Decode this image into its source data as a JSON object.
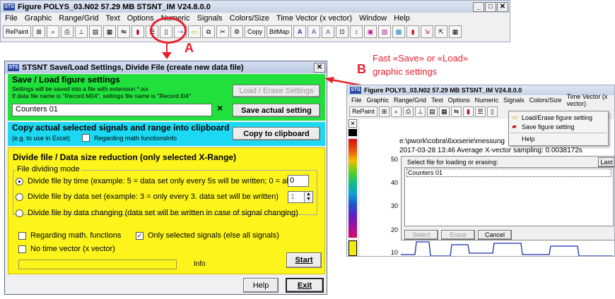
{
  "main_window": {
    "title": "Figure POLYS_03.N02  57.29 MB  STSNT_IM V24.8.0.0",
    "menu": [
      "File",
      "Graphic",
      "Range/Grid",
      "Text",
      "Options",
      "Numeric",
      "Signals",
      "Colors/Size",
      "Time Vector (x vector)",
      "Window",
      "Help"
    ],
    "toolbar": {
      "repaint": "RePaint",
      "copy": "Copy",
      "bitmap": "BitMap"
    }
  },
  "annotations": {
    "label_a": "A",
    "label_b": "B",
    "fast_text": "Fast «Save» or «Load»",
    "graphic_settings": "graphic settings",
    "arrow_color": "#e8202e"
  },
  "dialog": {
    "title": "STSNT Save/Load Settings, Divide File  (create new data file)",
    "save_load": {
      "heading": "Save / Load figure settings",
      "info1": "Settings will be saved into a file with extension *.ixx",
      "info2": "If data file name is \"Record.M04\", settings file name is \"Record.I04\"",
      "load_erase_btn": "Load / Erase Settings",
      "name_value": "Counters 01",
      "clear_x": "×",
      "save_btn": "Save actual setting"
    },
    "clipboard": {
      "heading": "Copy actual selected signals and range into clipboard",
      "sub": "(e.g. to use in Excel)",
      "math_label": "Regarding math functions",
      "info": "Info",
      "copy_btn": "Copy to clipboard"
    },
    "divide": {
      "heading": "Divide file / Data size reduction (only selected X-Range)",
      "group_label": "File dividing mode",
      "opt_time": "Divide file by time (example: 5 =  data set only every 5s will be written; 0 = all)",
      "opt_time_value": "0",
      "opt_set": "Divide file by data set (example: 3 = only every 3. data set will be written)",
      "opt_set_value": "1",
      "opt_change": "Divide file by data changing (data set will be written in case of signal changing)",
      "math_label": "Regarding math. functions",
      "only_selected_label": "Only selected signals (else all signals)",
      "no_time_label": "No time vector (x vector)",
      "info": "Info",
      "start_btn": "Start"
    },
    "help_btn": "Help",
    "exit_btn": "Exit"
  },
  "second_window": {
    "title": "Figure POLYS_03.N02  57.29 MB  STSNT_IM V24.8.0.0",
    "menu": [
      "File",
      "Graphic",
      "Range/Grid",
      "Text",
      "Options",
      "Numeric",
      "Signals",
      "Colors/Size",
      "Time Vector (x vector)"
    ],
    "repaint": "RePaint",
    "popup_items": [
      "Load/Erase figure setting",
      "Save figure setting",
      "Help"
    ],
    "path": "e:\\pwork\\cobra\\6xxserie\\messung",
    "stats": "2017-03-28 13:46    Average X-vector sampling: 0.0038172s",
    "y_ticks": [
      "50",
      "40",
      "30",
      "20",
      "10"
    ],
    "file_dialog": {
      "label": "Select file for loading or erasing:",
      "last_btn": "Last",
      "item": "Counters 01",
      "select_btn": "Select",
      "erase_btn": "Erase",
      "cancel_btn": "Cancel"
    }
  }
}
